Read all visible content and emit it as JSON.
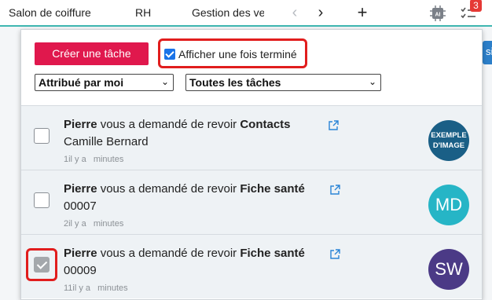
{
  "topbar": {
    "tabs": [
      "Salon de coiffure",
      "RH",
      "Gestion des ve"
    ],
    "nav_prev": "‹",
    "nav_next": "›",
    "add": "+",
    "task_badge": "3",
    "icons": [
      "ai-chip-icon",
      "task-list-icon"
    ]
  },
  "background": {
    "sliver_text": "si"
  },
  "panel": {
    "create_button": "Créer une tâche",
    "show_done_label": "Afficher une fois terminé",
    "assigned_select": "Attribué par moi",
    "filter_select": "Toutes les tâches",
    "accent_color": "#e0184d",
    "highlight_color": "#e11d1d"
  },
  "tasks": [
    {
      "requester": "Pierre",
      "action": "vous a demandé de revoir",
      "object": "Contacts",
      "subject": "Camille Bernard",
      "time_num": "1il y a",
      "time_unit": "minutes",
      "avatar": "EXEMPLE D'IMAGE",
      "avatar_line1": "EXEMPLE",
      "avatar_line2": "D'IMAGE",
      "checked": false
    },
    {
      "requester": "Pierre",
      "action": "vous a demandé de revoir",
      "object": "Fiche santé",
      "subject": "00007",
      "time_num": "2il y a",
      "time_unit": "minutes",
      "avatar": "MD",
      "checked": false
    },
    {
      "requester": "Pierre",
      "action": "vous a demandé de revoir",
      "object": "Fiche santé",
      "subject": "00009",
      "time_num": "11il y a",
      "time_unit": "minutes",
      "avatar": "SW",
      "checked": true
    }
  ]
}
